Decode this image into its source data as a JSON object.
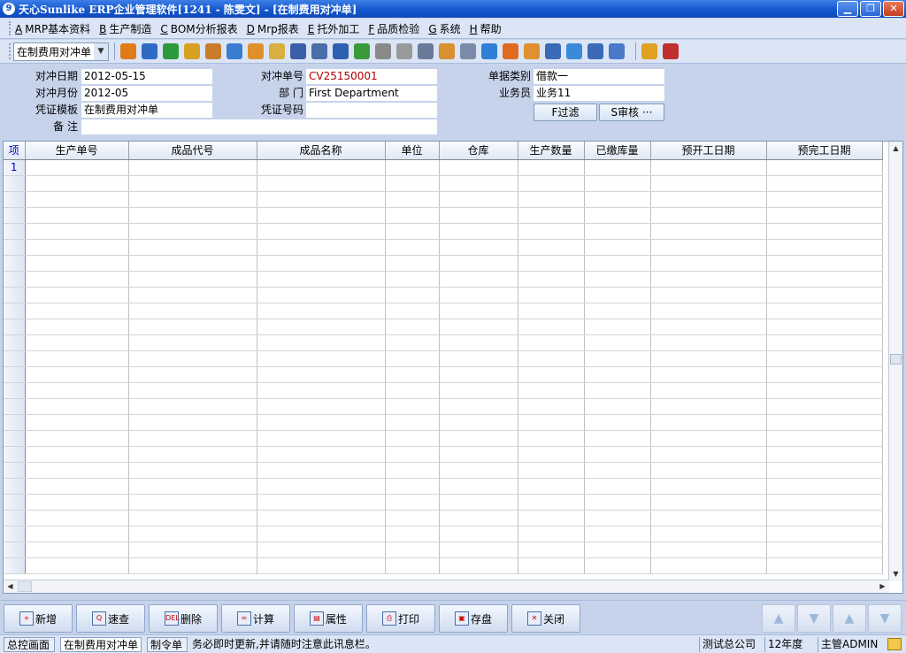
{
  "window": {
    "title": "天心Sunlike ERP企业管理软件[1241 - 陈雯文] - [在制费用对冲单]",
    "app_icon_glyph": "9",
    "minimize_glyph": "▁",
    "restore_glyph": "❐",
    "close_glyph": "✕"
  },
  "menu": {
    "items": [
      {
        "key": "A",
        "label": "MRP基本资料"
      },
      {
        "key": "B",
        "label": "生产制造"
      },
      {
        "key": "C",
        "label": "BOM分析报表"
      },
      {
        "key": "D",
        "label": "Mrp报表"
      },
      {
        "key": "E",
        "label": "托外加工"
      },
      {
        "key": "F",
        "label": "品质检验"
      },
      {
        "key": "G",
        "label": "系统"
      },
      {
        "key": "H",
        "label": "帮助"
      }
    ]
  },
  "toolbar": {
    "form_select": "在制费用对冲单",
    "select_arrow": "▼",
    "icons": [
      {
        "name": "tree-icon",
        "color": "#e07b1a"
      },
      {
        "name": "monitor-icon",
        "color": "#2f6bc4"
      },
      {
        "name": "phone-icon",
        "color": "#2c9a3a"
      },
      {
        "name": "key-icon",
        "color": "#d8a020"
      },
      {
        "name": "briefcase-icon",
        "color": "#c97c2b"
      },
      {
        "name": "home-icon",
        "color": "#3a7dd0"
      },
      {
        "name": "users-icon",
        "color": "#e0902a"
      },
      {
        "name": "mail-icon",
        "color": "#d8b040"
      },
      {
        "name": "book-icon",
        "color": "#3a5ea8"
      },
      {
        "name": "pin-icon",
        "color": "#4a6ea8"
      },
      {
        "name": "help-icon",
        "color": "#2f5fb0"
      },
      {
        "name": "dollar-icon",
        "color": "#3a9a3a"
      },
      {
        "name": "cart-icon",
        "color": "#8a8a8a"
      },
      {
        "name": "document-icon",
        "color": "#9a9a9a"
      },
      {
        "name": "calculator-icon",
        "color": "#6a7a9a"
      },
      {
        "name": "cabinet-icon",
        "color": "#d89030"
      },
      {
        "name": "copy-icon",
        "color": "#7a8aa8"
      },
      {
        "name": "check-icon",
        "color": "#2f7fd8"
      },
      {
        "name": "horn-icon",
        "color": "#e06a20"
      },
      {
        "name": "org-chart-icon",
        "color": "#e09030"
      },
      {
        "name": "screen-icon",
        "color": "#3a6ab8"
      },
      {
        "name": "refresh-icon",
        "color": "#3a8ad8"
      },
      {
        "name": "window-icon",
        "color": "#3a6ab8"
      },
      {
        "name": "close-window-icon",
        "color": "#4a7ac8"
      },
      {
        "name": "cascade-icon",
        "color": "#e0a020"
      },
      {
        "name": "exit-icon",
        "color": "#c03030"
      }
    ]
  },
  "form": {
    "date_label": "对冲日期",
    "date_value": "2012-05-15",
    "month_label": "对冲月份",
    "month_value": "2012-05",
    "template_label": "凭证模板",
    "template_value": "在制费用对冲单",
    "remark_label": "备    注",
    "remark_value": "",
    "number_label": "对冲单号",
    "number_value": "CV25150001",
    "dept_label": "部    门",
    "dept_value": "First Department",
    "voucher_label": "凭证号码",
    "voucher_value": "",
    "type_label": "单据类别",
    "type_value": "借款一",
    "sales_label": "业务员",
    "sales_value": "业务11",
    "filter_button": "F过滤",
    "audit_button": "S审核 ···"
  },
  "grid": {
    "row_header": "项",
    "columns": [
      "生产单号",
      "成品代号",
      "成品名称",
      "单位",
      "仓库",
      "生产数量",
      "已缴库量",
      "预开工日期",
      "预完工日期"
    ],
    "first_row_number": "1",
    "rows": []
  },
  "scroll": {
    "up": "▲",
    "down": "▼",
    "left": "◀",
    "right": "▶"
  },
  "actions": [
    {
      "label": "新增",
      "icon_name": "add-icon",
      "glyph": "+"
    },
    {
      "label": "速查",
      "icon_name": "search-icon",
      "glyph": "Q"
    },
    {
      "label": "删除",
      "icon_name": "delete-icon",
      "glyph": "DEL"
    },
    {
      "label": "计算",
      "icon_name": "calculate-icon",
      "glyph": "≈"
    },
    {
      "label": "属性",
      "icon_name": "properties-icon",
      "glyph": "▤"
    },
    {
      "label": "打印",
      "icon_name": "print-icon",
      "glyph": "⎙"
    },
    {
      "label": "存盘",
      "icon_name": "save-icon",
      "glyph": "▣"
    },
    {
      "label": "关闭",
      "icon_name": "close-icon",
      "glyph": "✕"
    }
  ],
  "nav": {
    "first": "▲",
    "prev": "▼",
    "next": "▲",
    "last": "▼"
  },
  "status": {
    "tab_home": "总控画面",
    "tab_current": "在制费用对冲单",
    "tab_third": "制令单",
    "message": "务必即时更新,并请随时注意此讯息栏。",
    "company": "测试总公司",
    "year": "12年度",
    "user": "主管ADMIN"
  }
}
